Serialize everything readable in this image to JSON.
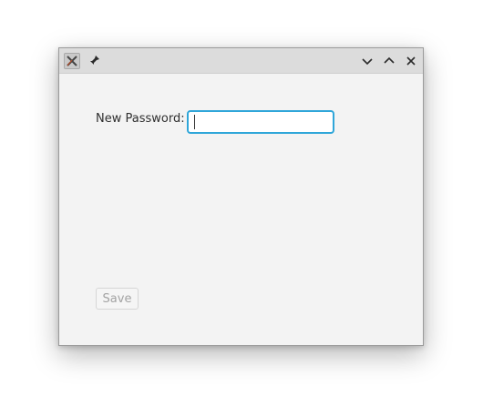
{
  "window": {
    "title_icons": {
      "app_icon": "app-x-icon",
      "pin_icon": "pin-icon"
    },
    "controls": {
      "minimize_icon": "chevron-down-icon",
      "maximize_icon": "chevron-up-icon",
      "close_icon": "close-icon"
    }
  },
  "form": {
    "password_label": "New Password:",
    "password_value": "",
    "save_label": "Save"
  },
  "colors": {
    "focus_accent": "#2fa6d9",
    "window_bg": "#f3f3f3",
    "titlebar_bg": "#dcdcdc",
    "disabled_text": "#a3a3a3"
  }
}
